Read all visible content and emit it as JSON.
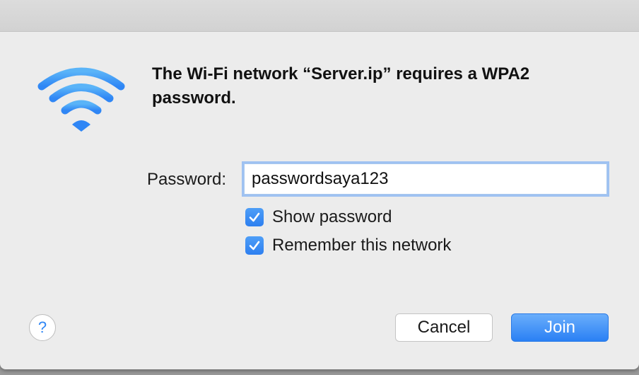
{
  "dialog": {
    "icon": "wifi-icon",
    "title": "The Wi-Fi network “Server.ip” requires a WPA2 password.",
    "password_label": "Password:",
    "password_value": "passwordsaya123",
    "show_password": {
      "label": "Show password",
      "checked": true
    },
    "remember_network": {
      "label": "Remember this network",
      "checked": true
    },
    "help_label": "?",
    "cancel_label": "Cancel",
    "join_label": "Join"
  },
  "colors": {
    "accent": "#2f86f5",
    "dialog_bg": "#ececec"
  }
}
